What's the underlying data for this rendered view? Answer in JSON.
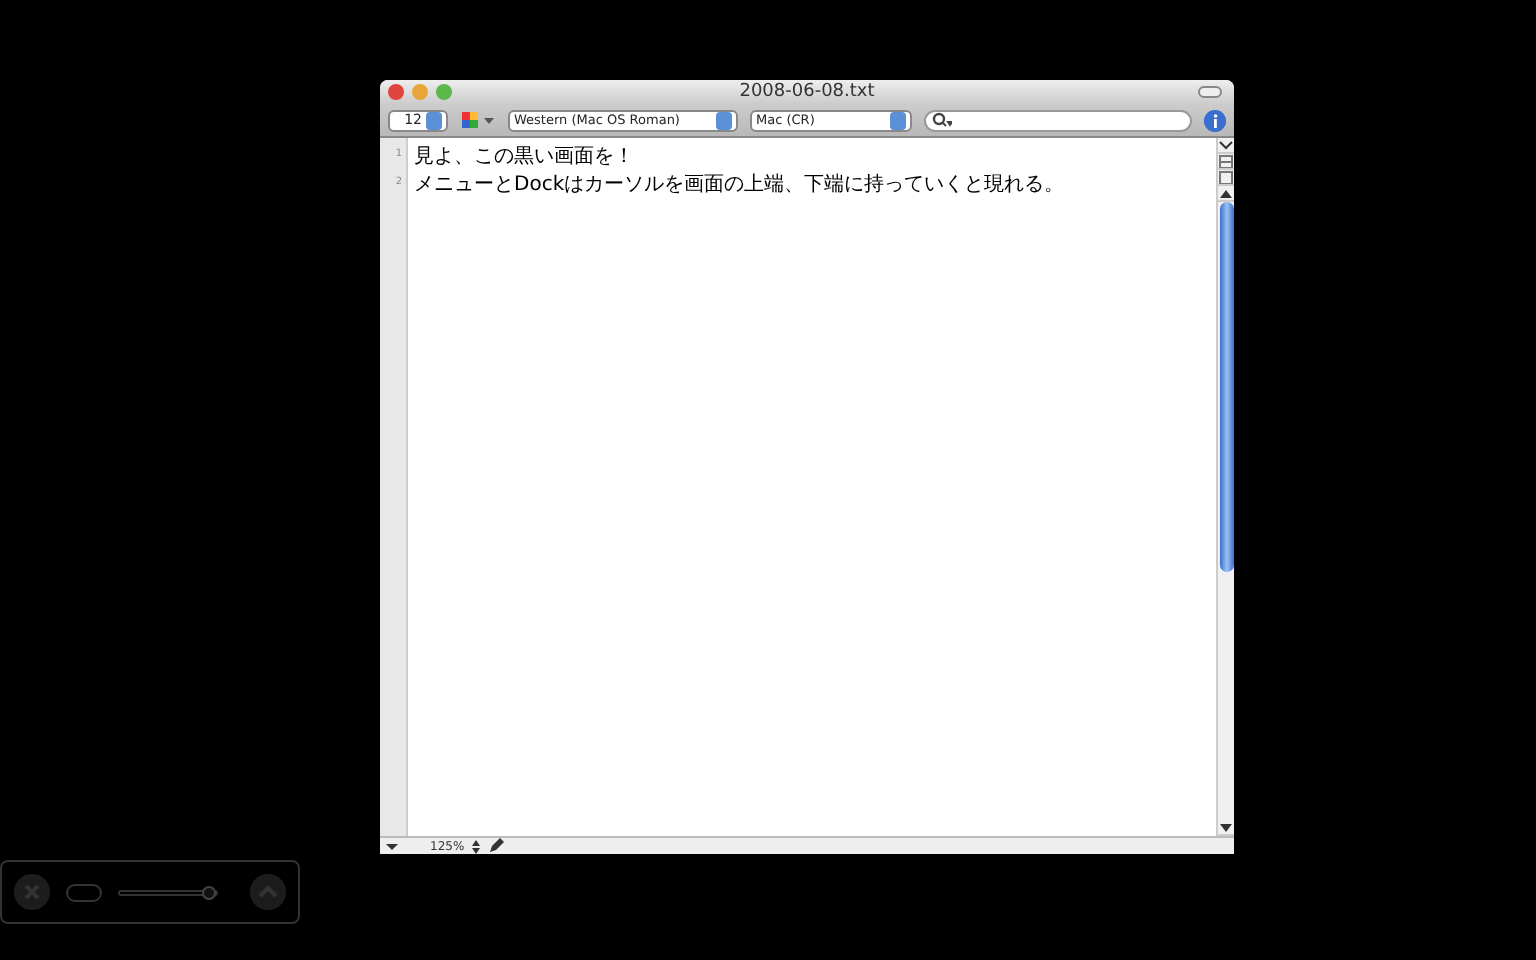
{
  "window": {
    "title": "2008-06-08.txt"
  },
  "toolbar": {
    "font_size": "12",
    "encoding": "Western (Mac OS Roman)",
    "line_endings": "Mac (CR)"
  },
  "lines": [
    {
      "number": "1",
      "text": "見よ、この黒い画面を！"
    },
    {
      "number": "2",
      "text": "メニューとDockはカーソルを画面の上端、下端に持っていくと現れる。"
    }
  ],
  "status_bar": {
    "zoom": "125%"
  },
  "scrollbar": {
    "level": 0.6
  },
  "hud": {
    "slider": {
      "level": 0.93
    }
  }
}
